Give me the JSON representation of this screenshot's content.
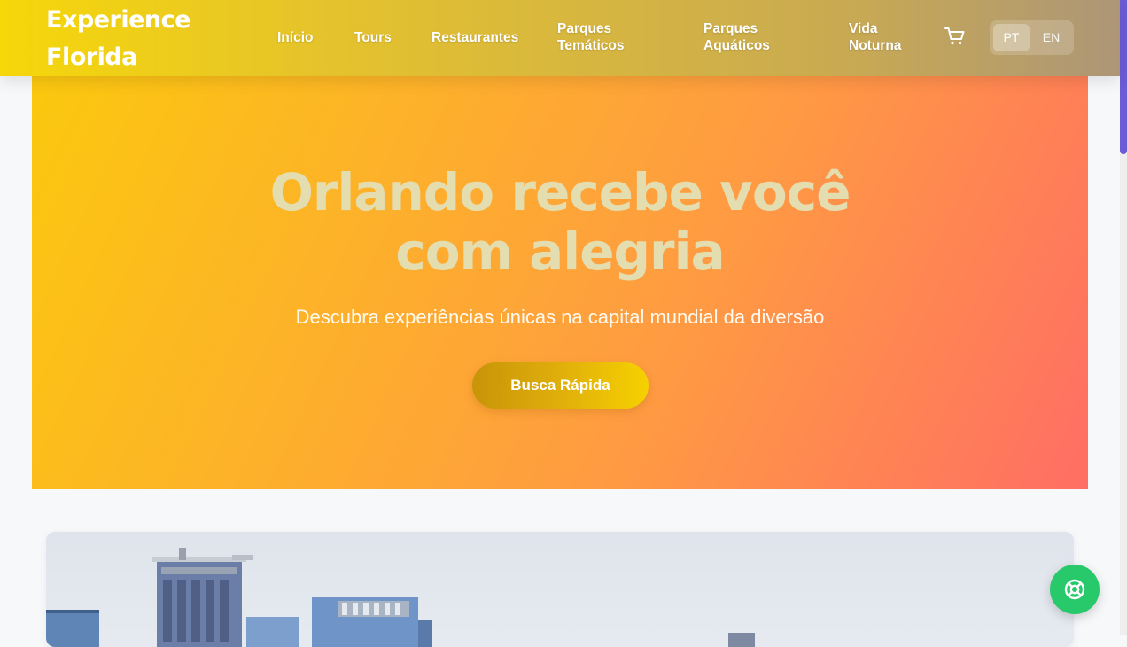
{
  "header": {
    "logo_line1": "Experience",
    "logo_line2": "Florida",
    "nav": {
      "inicio": "Início",
      "tours": "Tours",
      "restaurantes": "Restaurantes",
      "parques_tematicos_1": "Parques",
      "parques_tematicos_2": "Temáticos",
      "parques_aquaticos_1": "Parques",
      "parques_aquaticos_2": "Aquáticos",
      "vida_noturna_1": "Vida",
      "vida_noturna_2": "Noturna"
    },
    "cart_icon": "shopping-cart-icon",
    "lang": {
      "pt": "PT",
      "en": "EN",
      "selected": "PT"
    }
  },
  "hero": {
    "title_line1": "Orlando recebe você",
    "title_line2": "com alegria",
    "subtitle": "Descubra experiências únicas na capital mundial da diversão",
    "cta": "Busca Rápida"
  },
  "help_icon": "lifebuoy-icon",
  "colors": {
    "accent_green": "#27c96b",
    "scroll_thumb": "#6a5cd6",
    "hero_start": "#fbc80e",
    "hero_end": "#ff6e64"
  }
}
